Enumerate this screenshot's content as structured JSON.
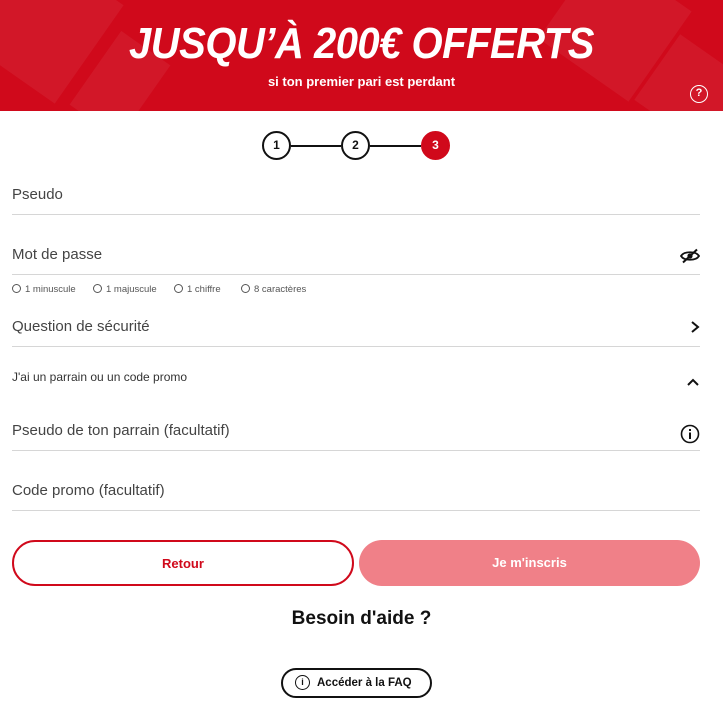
{
  "banner": {
    "title": "JUSQU’À 200€ OFFERTS",
    "subtitle": "si ton premier pari est perdant",
    "help_glyph": "?"
  },
  "stepper": {
    "steps": [
      "1",
      "2",
      "3"
    ],
    "active_step": "3"
  },
  "form": {
    "pseudo_label": "Pseudo",
    "password_label": "Mot de passe",
    "password_rules": [
      "1 minuscule",
      "1 majuscule",
      "1 chiffre",
      "8 caractères"
    ],
    "security_question_label": "Question de sécurité",
    "promo_toggle_label": "J'ai un parrain ou un code promo",
    "sponsor_label": "Pseudo de ton parrain (facultatif)",
    "promo_code_label": "Code promo (facultatif)"
  },
  "buttons": {
    "back_label": "Retour",
    "signup_label": "Je m'inscris"
  },
  "help": {
    "title": "Besoin d'aide ?",
    "faq_label": "Accéder à la FAQ",
    "faq_icon_glyph": "i"
  },
  "icons": {
    "password_visibility": "eye-slash-icon",
    "security_question_arrow": "chevron-right-icon",
    "promo_toggle_arrow": "chevron-up-icon",
    "sponsor_info": "info-icon"
  },
  "colors": {
    "brand_red": "#d0091b",
    "disabled_button": "#f08088"
  }
}
